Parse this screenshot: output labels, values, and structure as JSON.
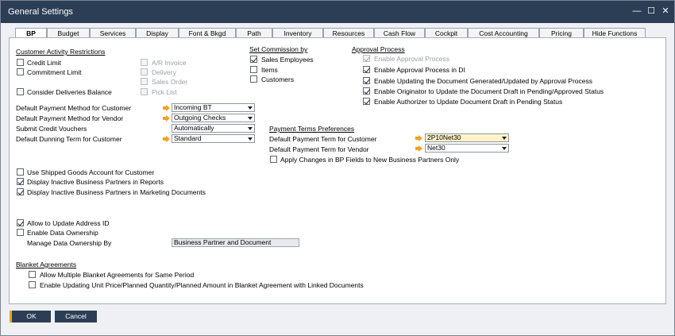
{
  "window": {
    "title": "General Settings",
    "minimize": "—",
    "maximize": "☐",
    "close": "✕"
  },
  "tabs": [
    {
      "label": "BP"
    },
    {
      "label": "Budget"
    },
    {
      "label": "Services"
    },
    {
      "label": "Display"
    },
    {
      "label": "Font & Bkgd"
    },
    {
      "label": "Path"
    },
    {
      "label": "Inventory"
    },
    {
      "label": "Resources"
    },
    {
      "label": "Cash Flow"
    },
    {
      "label": "Cockpit"
    },
    {
      "label": "Cost Accounting"
    },
    {
      "label": "Pricing"
    },
    {
      "label": "Hide Functions"
    }
  ],
  "customer_activity": {
    "header": "Customer Activity Restrictions",
    "credit_limit": "Credit Limit",
    "commitment_limit": "Commitment Limit",
    "consider_deliveries": "Consider Deliveries Balance",
    "ar_invoice": "A/R Invoice",
    "delivery": "Delivery",
    "sales_order": "Sales Order",
    "pick_list": "Pick List"
  },
  "commission": {
    "header": "Set Commission by",
    "sales_employees": "Sales Employees",
    "items": "Items",
    "customers": "Customers"
  },
  "approval": {
    "header": "Approval Process",
    "enable_process": "Enable Approval Process",
    "enable_di": "Enable Approval Process in DI",
    "enable_updating": "Enable Updating the Document Generated/Updated by Approval Process",
    "enable_originator": "Enable Originator to Update the Document Draft in Pending/Approved Status",
    "enable_authorizer": "Enable Authorizer to Update Document Draft in Pending Status"
  },
  "defaults": {
    "pm_customer_label": "Default Payment Method for Customer",
    "pm_customer_value": "Incoming BT",
    "pm_vendor_label": "Default Payment Method for Vendor",
    "pm_vendor_value": "Outgoing Checks",
    "vouchers_label": "Submit Credit Vouchers",
    "vouchers_value": "Automatically",
    "dunning_label": "Default Dunning Term for Customer",
    "dunning_value": "Standard"
  },
  "payment_terms": {
    "header": "Payment Terms Preferences",
    "customer_label": "Default Payment Term for Customer",
    "customer_value": "2P10Net30",
    "vendor_label": "Default Payment Term for Vendor",
    "vendor_value": "Net30",
    "apply_changes": "Apply Changes in BP Fields to New Business Partners Only"
  },
  "options": {
    "shipped_goods": "Use Shipped Goods Account for Customer",
    "inactive_reports": "Display Inactive Business Partners in Reports",
    "inactive_marketing": "Display Inactive Business Partners in Marketing Documents",
    "allow_address": "Allow to Update Address ID",
    "enable_ownership": "Enable Data Ownership",
    "manage_ownership_label": "Manage Data Ownership By",
    "manage_ownership_value": "Business Partner and Document"
  },
  "blanket": {
    "header": "Blanket Agreements",
    "allow_multiple": "Allow Multiple Blanket Agreements for Same Period",
    "enable_updating": "Enable Updating Unit Price/Planned Quantity/Planned Amount in Blanket Agreement with Linked Documents"
  },
  "buttons": {
    "ok": "OK",
    "cancel": "Cancel"
  },
  "colors": {
    "titlebar": "#2c3e55",
    "accent": "#f0a21d",
    "highlight": "#fff4c8"
  }
}
